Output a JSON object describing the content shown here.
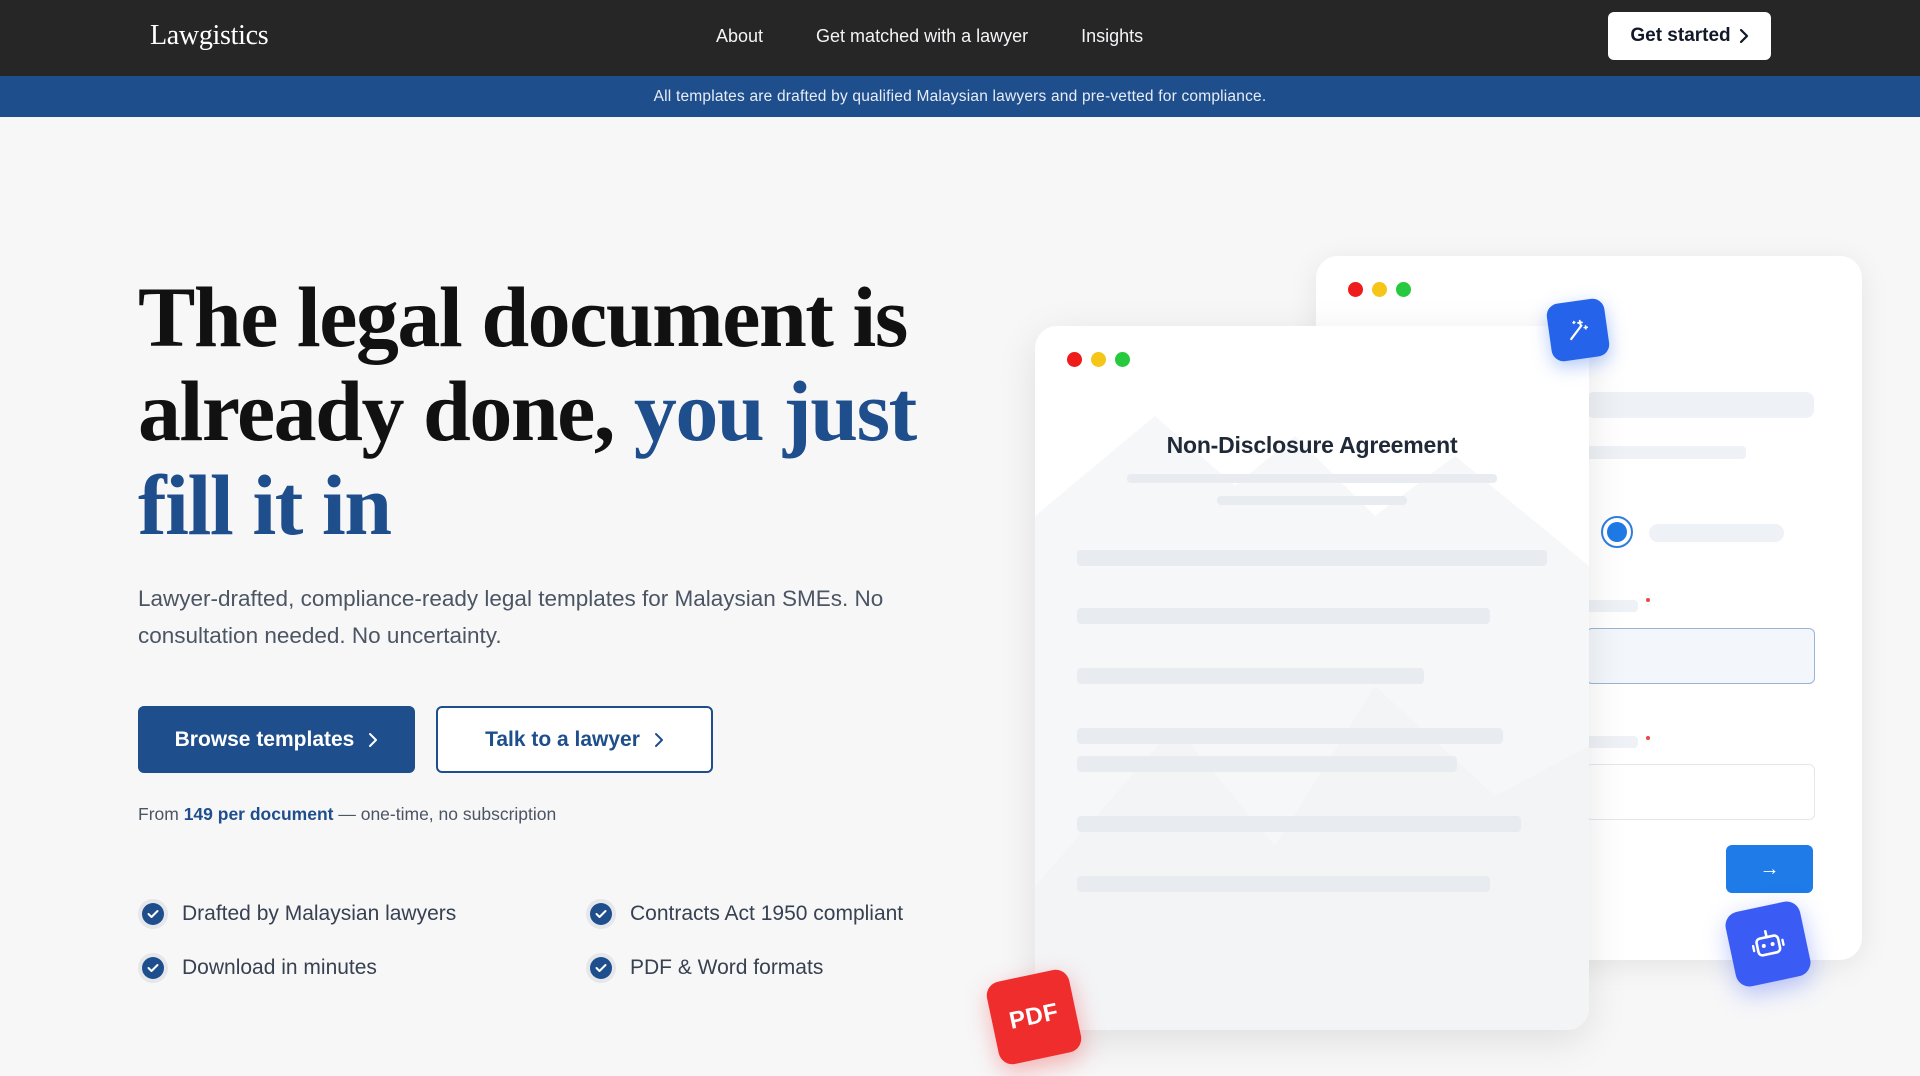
{
  "nav": {
    "brand": "Lawgistics",
    "links": [
      "About",
      "Get matched with a lawyer",
      "Insights"
    ],
    "cta_label": "Get started"
  },
  "banner": {
    "text": "All templates are drafted by qualified Malaysian lawyers and pre-vetted for compliance."
  },
  "hero": {
    "headline_part1": "The legal document is already done,",
    "headline_accent": "you just fill it in",
    "subtext": "Lawyer-drafted, compliance-ready legal templates for Malaysian SMEs. No consultation needed. No uncertainty.",
    "primary_button": "Browse templates",
    "secondary_button": "Talk to a lawyer",
    "pricing_prefix": "From",
    "pricing_amount": "149 per document",
    "pricing_suffix": "— one-time, no subscription",
    "features": [
      "Drafted by Malaysian lawyers",
      "Contracts Act 1950 compliant",
      "Download in minutes",
      "PDF & Word formats"
    ]
  },
  "mockup": {
    "document_title": "Non-Disclosure Agreement",
    "pdf_badge": "PDF",
    "arrow_glyph": "→"
  },
  "colors": {
    "nav_bg": "#262626",
    "brand_blue": "#1f4e8c",
    "page_bg": "#f7f7f8",
    "action_blue": "#1e7be8",
    "pdf_red": "#ef2d2d"
  },
  "icons": {
    "chevron": "chevron-right-icon",
    "check": "check-circle-icon",
    "wand": "magic-wand-icon",
    "bot": "robot-icon"
  }
}
